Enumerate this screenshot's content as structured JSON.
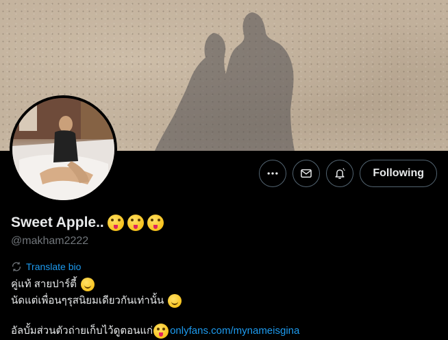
{
  "banner": {
    "alt": "shadow silhouettes on sand"
  },
  "actions": {
    "more_icon": "more-icon",
    "message_icon": "mail-icon",
    "notify_icon": "bell-icon",
    "following_label": "Following"
  },
  "profile": {
    "display_name": "Sweet Apple..",
    "handle": "@makham2222",
    "translate_label": "Translate bio",
    "bio_line1": "คู่แท้ สายปาร์ตี้",
    "bio_line2": "นัดแต่เพื่อนๆรุสนิยมเดียวกันเท่านั้น",
    "bio_line3_text": "อัลบั้มส่วนตัวถ่ายเก็บไว้ดูตอนแก่",
    "bio_link": "onlyfans.com/mynameisgina"
  },
  "colors": {
    "accent": "#1d9bf0",
    "muted": "#71767b",
    "border": "#536471"
  }
}
